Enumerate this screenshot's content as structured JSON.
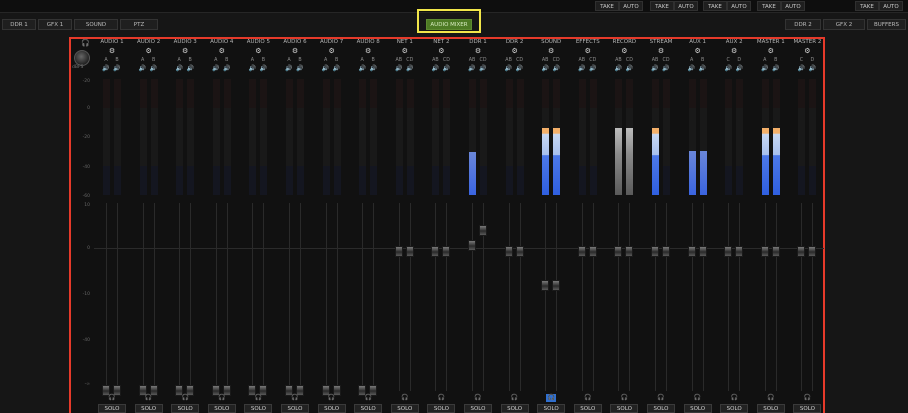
{
  "topbar": {
    "buttons": [
      "TAKE",
      "AUTO",
      "TAKE",
      "AUTO",
      "TAKE",
      "AUTO",
      "TAKE",
      "AUTO",
      "TAKE",
      "AUTO"
    ]
  },
  "tabs": {
    "left": [
      "DDR 1",
      "GFX 1",
      "SOUND",
      "PTZ"
    ],
    "center": "AUDIO MIXER",
    "right": [
      "DDR 2",
      "GFX 2",
      "BUFFERS"
    ]
  },
  "mixer": {
    "dbfs_label": "dBFS",
    "meter_scale": [
      "-20",
      "0",
      "-20",
      "-40",
      "-60"
    ],
    "fader_scale": [
      "10",
      "0",
      "-10",
      "-40",
      "-∞"
    ],
    "solo_label": "SOLO",
    "accent_color": "#2f6fd0",
    "strips": [
      {
        "name": "AUDIO 1",
        "buses": [
          "A",
          "B"
        ],
        "meters": [
          0,
          0
        ],
        "fader": 0.0
      },
      {
        "name": "AUDIO 2",
        "buses": [
          "A",
          "B"
        ],
        "meters": [
          0,
          0
        ],
        "fader": 0.0
      },
      {
        "name": "AUDIO 3",
        "buses": [
          "A",
          "B"
        ],
        "meters": [
          0,
          0
        ],
        "fader": 0.0
      },
      {
        "name": "AUDIO 4",
        "buses": [
          "A",
          "B"
        ],
        "meters": [
          0,
          0
        ],
        "fader": 0.0
      },
      {
        "name": "AUDIO 5",
        "buses": [
          "A",
          "B"
        ],
        "meters": [
          0,
          0
        ],
        "fader": 0.0
      },
      {
        "name": "AUDIO 6",
        "buses": [
          "A",
          "B"
        ],
        "meters": [
          0,
          0
        ],
        "fader": 0.0
      },
      {
        "name": "AUDIO 7",
        "buses": [
          "A",
          "B"
        ],
        "meters": [
          0,
          0
        ],
        "fader": 0.0
      },
      {
        "name": "AUDIO 8",
        "buses": [
          "A",
          "B"
        ],
        "meters": [
          0,
          0
        ],
        "fader": 0.0
      },
      {
        "name": "NET 1",
        "buses": [
          "AB",
          "CD"
        ],
        "meters": [
          0,
          0
        ],
        "fader": 0.74
      },
      {
        "name": "NET 2",
        "buses": [
          "AB",
          "CD"
        ],
        "meters": [
          0,
          0
        ],
        "fader": 0.74
      },
      {
        "name": "DDR 1",
        "buses": [
          "AB",
          "CD"
        ],
        "meters": [
          0.37,
          0
        ],
        "fader": 0.79
      },
      {
        "name": "DDR 2",
        "buses": [
          "AB",
          "CD"
        ],
        "meters": [
          0,
          0
        ],
        "fader": 0.74
      },
      {
        "name": "SOUND",
        "buses": [
          "AB",
          "CD"
        ],
        "meters": [
          0.58,
          0.58
        ],
        "fader": 0.56
      },
      {
        "name": "EFFECTS",
        "buses": [
          "AB",
          "CD"
        ],
        "meters": [
          0,
          0
        ],
        "fader": 0.74
      },
      {
        "name": "RECORD",
        "buses": [
          "AB",
          "CD"
        ],
        "meters": [
          0.58,
          0.58
        ],
        "fader": 0.74
      },
      {
        "name": "STREAM",
        "buses": [
          "AB",
          "CD"
        ],
        "meters": [
          0.58,
          0
        ],
        "fader": 0.74
      },
      {
        "name": "AUX 1",
        "buses": [
          "A",
          "B"
        ],
        "meters": [
          0.38,
          0.38
        ],
        "fader": 0.74
      },
      {
        "name": "AUX 2",
        "buses": [
          "C",
          "D"
        ],
        "meters": [
          0,
          0
        ],
        "fader": 0.74
      },
      {
        "name": "MASTER 1",
        "buses": [
          "A",
          "B"
        ],
        "meters": [
          0.58,
          0.58
        ],
        "fader": 0.74
      },
      {
        "name": "MASTER 2",
        "buses": [
          "C",
          "D"
        ],
        "meters": [
          0,
          0
        ],
        "fader": 0.74
      }
    ]
  }
}
